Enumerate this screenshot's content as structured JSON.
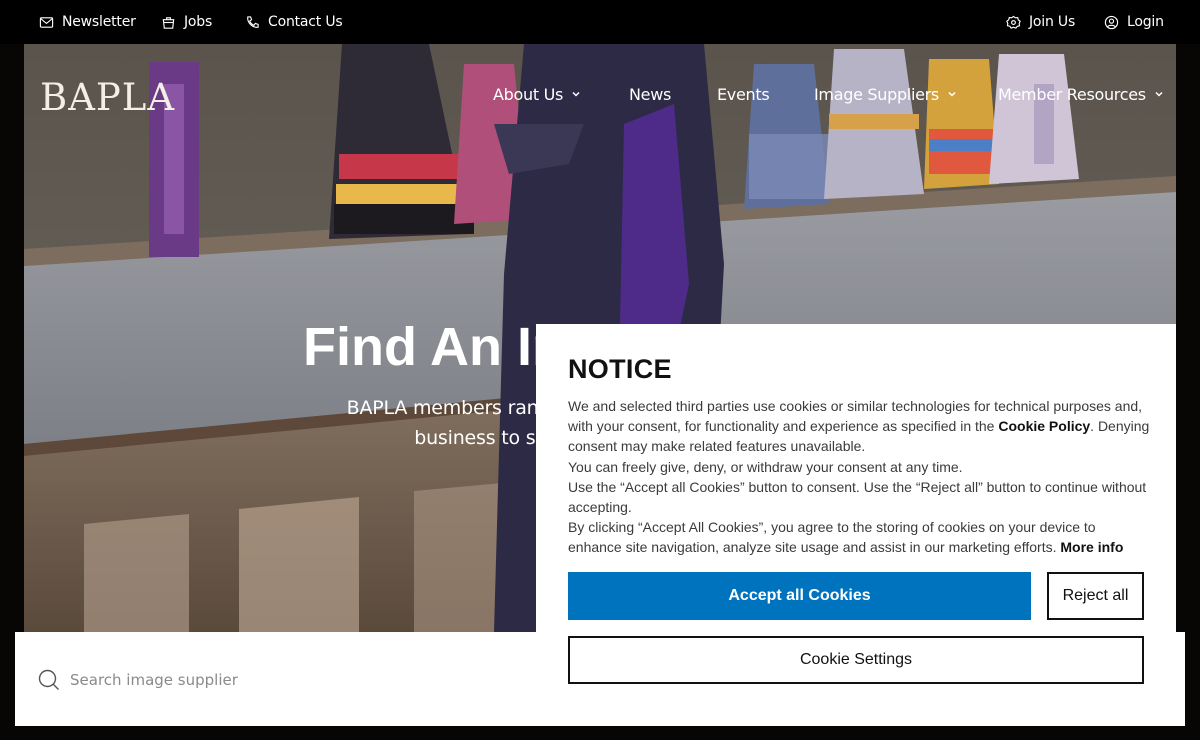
{
  "topbar": {
    "newsletter": "Newsletter",
    "jobs": "Jobs",
    "contact": "Contact Us",
    "join": "Join Us",
    "login": "Login"
  },
  "logo": "BAPLA",
  "nav": {
    "about": "About Us",
    "news": "News",
    "events": "Events",
    "suppliers": "Image Suppliers",
    "resources": "Member Resources"
  },
  "hero": {
    "title": "Find An Image Supplier",
    "subtitle_line1": "BAPLA members range from the world's largest image",
    "subtitle_line2": "business to small independent libraries."
  },
  "search": {
    "placeholder": "Search image supplier"
  },
  "notice": {
    "title": "NOTICE",
    "p1_a": "We and selected third parties use cookies or similar technologies for technical purposes and, with your consent, for functionality and experience as specified in the ",
    "p1_link": "Cookie Policy",
    "p1_b": ". Denying consent may make related features unavailable.",
    "p2": "You can freely give, deny, or withdraw your consent at any time.",
    "p3": "Use the “Accept all Cookies” button to consent. Use the “Reject all” button to continue without accepting.",
    "p4": "By clicking “Accept All Cookies”, you agree to the storing of cookies on your device to enhance site navigation, analyze site usage and assist in our marketing efforts. ",
    "p4_link": "More info",
    "accept": "Accept all Cookies",
    "reject": "Reject all",
    "settings": "Cookie Settings"
  },
  "colors": {
    "accent": "#0073bf",
    "topbar": "#000000"
  }
}
